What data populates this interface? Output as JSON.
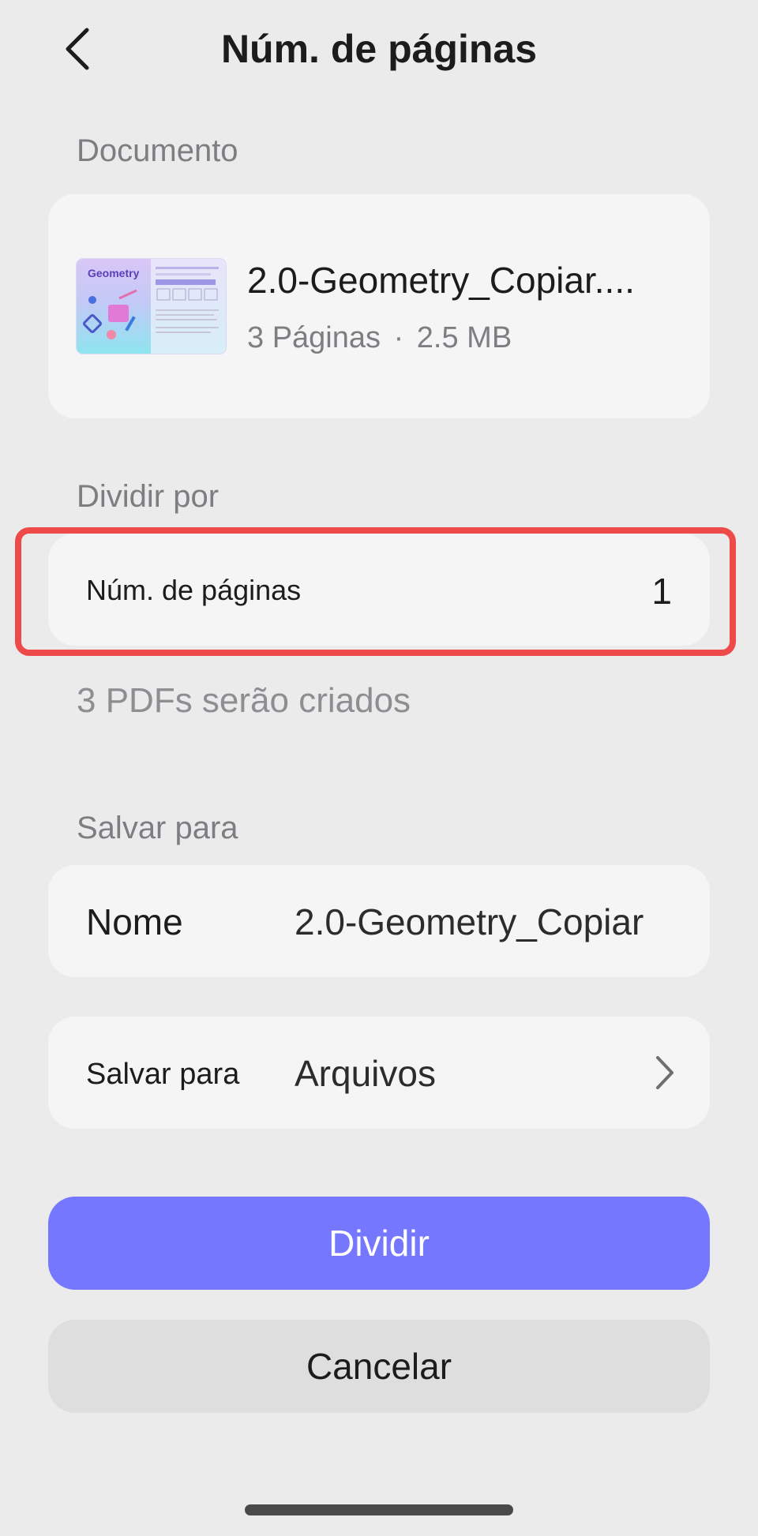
{
  "header": {
    "title": "Núm. de páginas",
    "back_icon": "chevron-left-icon"
  },
  "document_section": {
    "label": "Documento",
    "file": {
      "name": "2.0-Geometry_Copiar....",
      "pages": "3 Páginas",
      "separator": "·",
      "size": "2.5 MB",
      "thumbnail_text": "Geometry"
    }
  },
  "split_section": {
    "label": "Dividir por",
    "option_label": "Núm. de páginas",
    "option_value": "1",
    "result_text": "3 PDFs serão criados",
    "highlight_color": "#ef4a4a"
  },
  "save_section": {
    "label": "Salvar para",
    "name_row": {
      "label": "Nome",
      "value": "2.0-Geometry_Copiar"
    },
    "location_row": {
      "label": "Salvar para",
      "value": "Arquivos",
      "icon": "chevron-right-icon"
    }
  },
  "actions": {
    "primary_label": "Dividir",
    "primary_color": "#7677ff",
    "secondary_label": "Cancelar"
  }
}
